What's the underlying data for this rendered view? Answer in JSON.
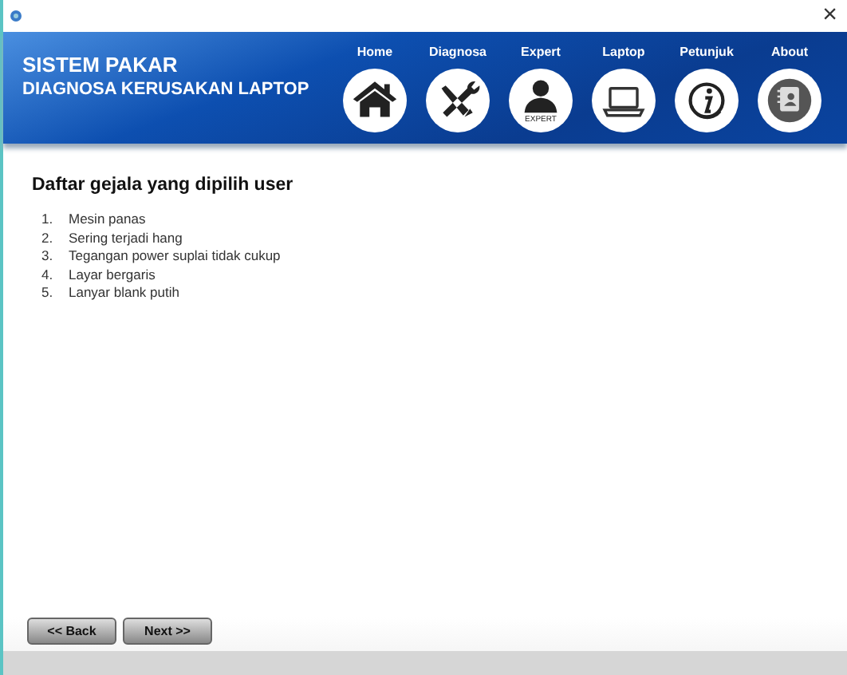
{
  "header": {
    "title": "SISTEM PAKAR",
    "subtitle": "DIAGNOSA KERUSAKAN LAPTOP"
  },
  "nav": [
    {
      "kind": "home",
      "label": "Home"
    },
    {
      "kind": "tools",
      "label": "Diagnosa"
    },
    {
      "kind": "expert",
      "label": "Expert",
      "caption": "EXPERT"
    },
    {
      "kind": "laptop",
      "label": "Laptop"
    },
    {
      "kind": "info",
      "label": "Petunjuk"
    },
    {
      "kind": "contacts",
      "label": "About"
    }
  ],
  "heading": "Daftar gejala yang dipilih user",
  "symptoms": [
    {
      "number": "1.",
      "text": "Mesin panas"
    },
    {
      "number": "2.",
      "text": "Sering terjadi hang"
    },
    {
      "number": "3.",
      "text": "Tegangan power suplai tidak cukup"
    },
    {
      "number": "4.",
      "text": "Layar bergaris"
    },
    {
      "number": "5.",
      "text": "Lanyar blank putih"
    }
  ],
  "buttons": [
    "<< Back",
    "Next >>"
  ],
  "window": {
    "close": "×"
  }
}
